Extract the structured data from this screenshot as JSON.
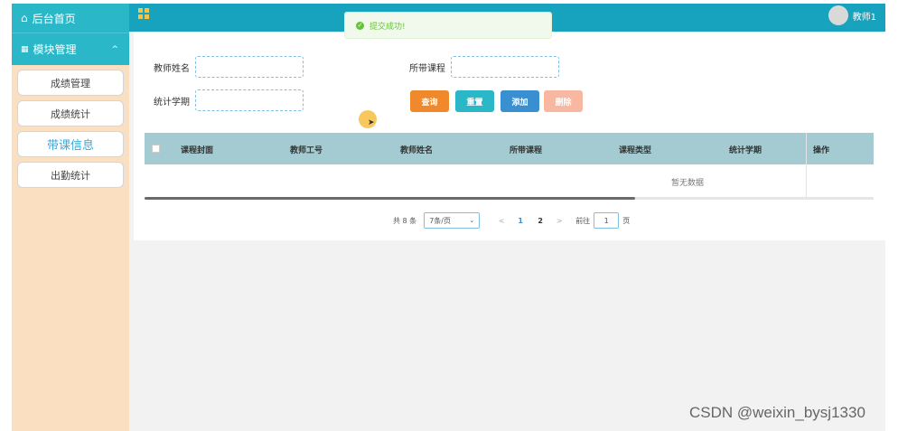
{
  "sidebar": {
    "home": {
      "label": "后台首页",
      "icon": "home-icon"
    },
    "section": {
      "label": "模块管理",
      "icon": "module-grid-icon",
      "caret": "^"
    },
    "items": [
      {
        "label": "成绩管理",
        "active": false
      },
      {
        "label": "成绩统计",
        "active": false
      },
      {
        "label": "带课信息",
        "active": true
      },
      {
        "label": "出勤统计",
        "active": false
      }
    ]
  },
  "topbar": {
    "menu_icon": "grid-menu-icon",
    "user_name": "教师1",
    "avatar_icon": "avatar"
  },
  "toast": {
    "text": "提交成功!",
    "icon": "success-check-icon",
    "color": "#67c23a"
  },
  "form": {
    "teacher_name_label": "教师姓名",
    "course_label": "所带课程",
    "term_label": "统计学期",
    "teacher_name_value": "",
    "course_value": "",
    "term_value": ""
  },
  "buttons": {
    "search": "查询",
    "reset": "重置",
    "add": "添加",
    "delete": "删除"
  },
  "table": {
    "columns": [
      "课程封面",
      "教师工号",
      "教师姓名",
      "所带课程",
      "课程类型",
      "统计学期",
      "操作"
    ],
    "empty_text": "暂无数据",
    "rows": []
  },
  "pagination": {
    "total": "共 8 条",
    "page_size": "7条/页",
    "prev": "<",
    "pages": [
      "1",
      "2"
    ],
    "current": "1",
    "next": ">",
    "goto_label": "前往",
    "goto_value": "1",
    "page_suffix": "页"
  },
  "watermark": "CSDN @weixin_bysj1330",
  "colors": {
    "accent": "#17a3bd",
    "sidebar_bg": "#fae0c1",
    "header_row": "#a4cbd1",
    "search_btn": "#f0892b",
    "reset_btn": "#2ab8c9",
    "add_btn": "#3a8fd1",
    "delete_btn": "#f8b7a0"
  }
}
